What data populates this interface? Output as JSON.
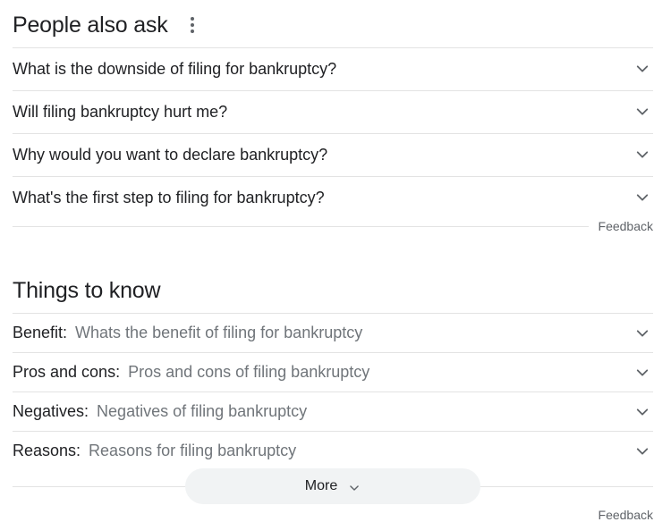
{
  "people_also_ask": {
    "title": "People also ask",
    "questions": [
      "What is the downside of filing for bankruptcy?",
      "Will filing bankruptcy hurt me?",
      "Why would you want to declare bankruptcy?",
      "What's the first step to filing for bankruptcy?"
    ],
    "feedback_label": "Feedback"
  },
  "things_to_know": {
    "title": "Things to know",
    "items": [
      {
        "label": "Benefit:",
        "text": "Whats the benefit of filing for bankruptcy"
      },
      {
        "label": "Pros and cons:",
        "text": "Pros and cons of filing bankruptcy"
      },
      {
        "label": "Negatives:",
        "text": "Negatives of filing bankruptcy"
      },
      {
        "label": "Reasons:",
        "text": "Reasons for filing bankruptcy"
      }
    ],
    "more_label": "More",
    "feedback_label": "Feedback"
  },
  "icons": {
    "more_options": "more-vert-icon",
    "expand": "chevron-down-icon"
  },
  "colors": {
    "text_primary": "#202124",
    "text_secondary": "#70757a",
    "divider": "#e3e3e3",
    "more_button_bg": "#f1f3f4"
  }
}
